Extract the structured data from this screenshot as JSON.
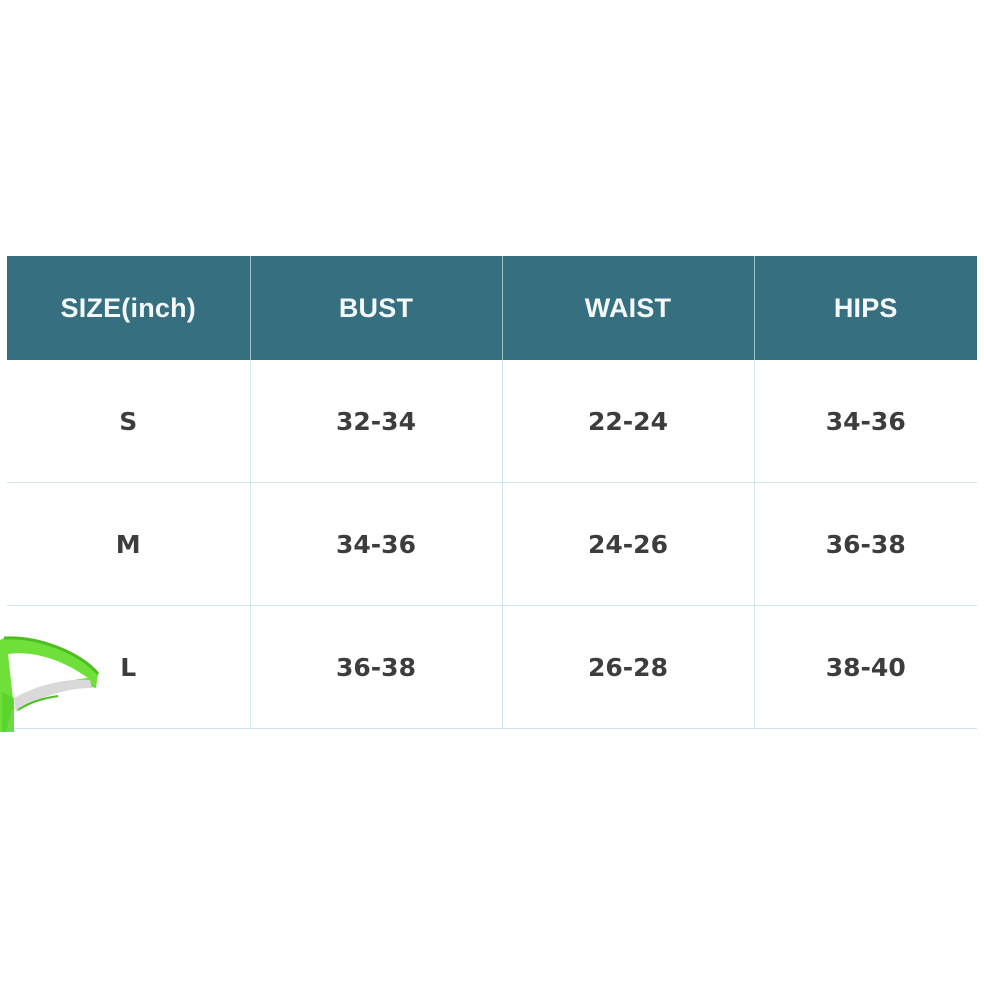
{
  "table": {
    "headers": [
      "SIZE(inch)",
      "BUST",
      "WAIST",
      "HIPS"
    ],
    "rows": [
      [
        "S",
        "32-34",
        "22-24",
        "34-36"
      ],
      [
        "M",
        "34-36",
        "24-26",
        "36-38"
      ],
      [
        "L",
        "36-38",
        "26-28",
        "38-40"
      ]
    ]
  },
  "colors": {
    "header_background": "#356f80",
    "header_text": "#f4f8f9",
    "cell_text": "#3d3d3d",
    "grid_lines": "#cfe6ec",
    "decoration_green": "#6fe03a"
  },
  "decoration": {
    "icon": "green-garment-fragment"
  }
}
